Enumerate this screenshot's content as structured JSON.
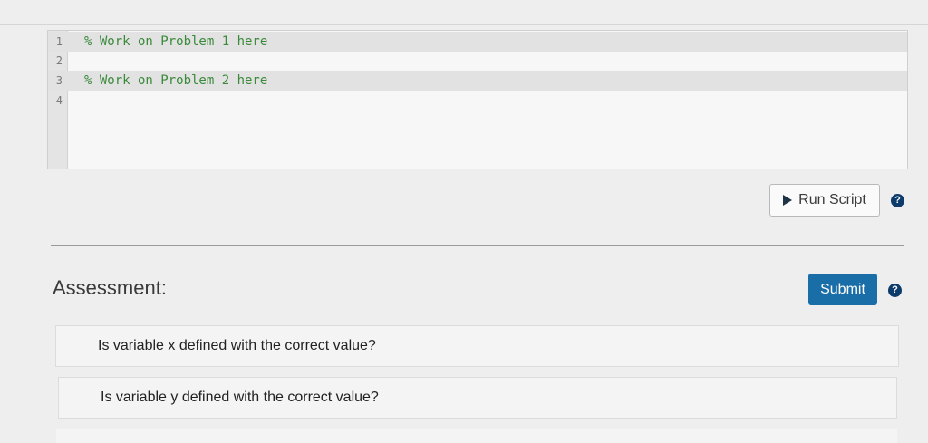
{
  "editor": {
    "lines": [
      {
        "number": "1",
        "code": "% Work on Problem 1 here"
      },
      {
        "number": "2",
        "code": ""
      },
      {
        "number": "3",
        "code": "% Work on Problem 2 here"
      },
      {
        "number": "4",
        "code": ""
      }
    ]
  },
  "run_button": {
    "label": "Run Script",
    "icon": "play-icon"
  },
  "help_icon": {
    "glyph": "?"
  },
  "assessment": {
    "title": "Assessment:",
    "submit_label": "Submit",
    "items": [
      {
        "text": "Is variable x defined with the correct value?"
      },
      {
        "text": "Is variable y defined with the correct value?"
      }
    ]
  },
  "colors": {
    "submit": "#1a6ea8",
    "help_icon": "#0d3b6b",
    "comment": "#3b8a3b"
  }
}
